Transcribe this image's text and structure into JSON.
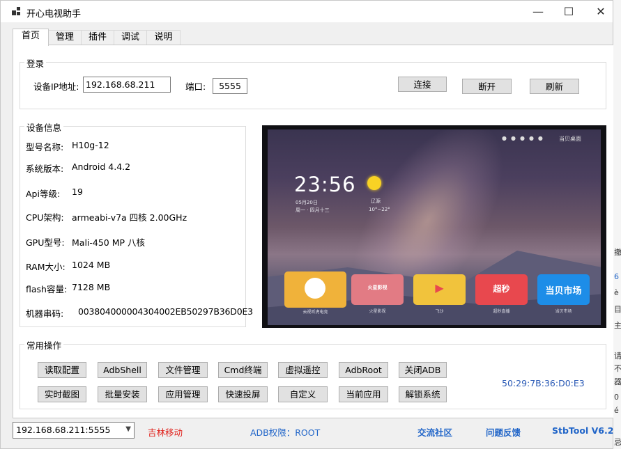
{
  "window": {
    "title": "开心电视助手",
    "minimize": "—",
    "maximize": "☐",
    "close": "✕"
  },
  "tabs": [
    "首页",
    "管理",
    "插件",
    "调试",
    "说明"
  ],
  "login": {
    "legend": "登录",
    "ip_label": "设备IP地址:",
    "ip_value": "192.168.68.211",
    "port_label": "端口:",
    "port_value": "5555",
    "buttons": {
      "connect": "连接",
      "disconnect": "断开",
      "refresh": "刷新"
    }
  },
  "device_info": {
    "legend": "设备信息",
    "rows": [
      {
        "label": "型号名称:",
        "value": "H10g-12"
      },
      {
        "label": "系统版本:",
        "value": "Android 4.4.2"
      },
      {
        "label": "Api等级:",
        "value": "19"
      },
      {
        "label": "CPU架构:",
        "value": "armeabi-v7a 四核 2.00GHz"
      },
      {
        "label": "GPU型号:",
        "value": "Mali-450 MP 八核"
      },
      {
        "label": "RAM大小:",
        "value": "1024 MB"
      },
      {
        "label": "flash容量:",
        "value": "7128 MB"
      },
      {
        "label": "机器串码:",
        "value": "003804000004304002EB50297B36D0E3"
      }
    ]
  },
  "tv_preview": {
    "clock": "23:56",
    "date": "05月20日",
    "weekday": "周一 · 四月十三",
    "city": "辽源",
    "temperature": "10°~22°",
    "brand": "当贝桌面",
    "top_icons": "●●●●●",
    "tiles": [
      {
        "label": "云视听虎电竞",
        "color": "#f0b23a",
        "text": ""
      },
      {
        "label": "火星影视",
        "color": "#e27b84",
        "text": "火星影视"
      },
      {
        "label": "飞沙",
        "color": "#f1c33c",
        "text": "▶"
      },
      {
        "label": "超秒直播",
        "color": "#e8484e",
        "text": "超秒"
      },
      {
        "label": "当贝市场",
        "color": "#1d8de8",
        "text": "当贝市场"
      }
    ]
  },
  "common_ops": {
    "legend": "常用操作",
    "row1": [
      "读取配置",
      "AdbShell",
      "文件管理",
      "Cmd终端",
      "虚拟遥控",
      "AdbRoot",
      "关闭ADB"
    ],
    "row2": [
      "实时截图",
      "批量安装",
      "应用管理",
      "快速投屏",
      "自定义",
      "当前应用",
      "解锁系统"
    ],
    "mac": "50:29:7B:36:D0:E3"
  },
  "status": {
    "device_select": "192.168.68.211:5555",
    "isp": "吉林移动",
    "adb_permission": "ADB权限：ROOT",
    "community": "交流社区",
    "feedback": "问题反馈",
    "version": "StbTool V6.2"
  },
  "background_window": {
    "chars": [
      "撤",
      "6",
      "è",
      "目",
      "主",
      "请",
      "不",
      "器",
      "0",
      "é",
      "忌"
    ]
  },
  "colors": {
    "accent_blue": "#1f64c8",
    "status_red": "#e0201a",
    "mac_blue": "#2a5ab6"
  }
}
